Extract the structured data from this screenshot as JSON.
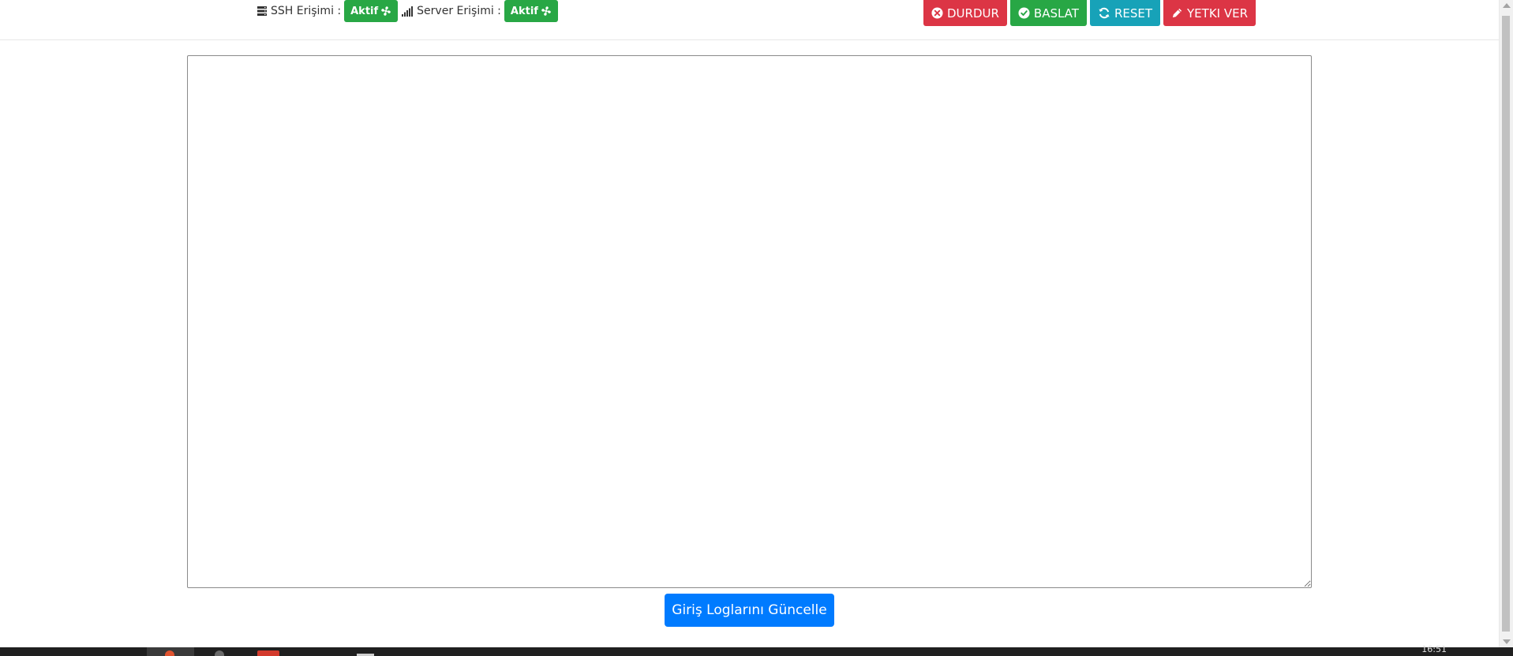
{
  "header": {
    "ssh_label": "SSH Erişimi :",
    "ssh_status": "Aktif",
    "server_label": "Server Erişimi :",
    "server_status": "Aktif"
  },
  "actions": {
    "stop": "DURDUR",
    "start": "BASLAT",
    "reset": "RESET",
    "grant": "YETKI VER"
  },
  "log": {
    "value": ""
  },
  "update_button": "Giriş Loglarını Güncelle",
  "taskbar": {
    "clock": "16:51"
  },
  "colors": {
    "success": "#28a745",
    "danger": "#dc3545",
    "info": "#17a2b8",
    "primary": "#007bff"
  },
  "icons": {
    "ssh": "server-stack-icon",
    "server": "signal-bars-icon",
    "badge": "fan-icon",
    "stop": "circle-x-icon",
    "start": "circle-check-icon",
    "reset": "refresh-icon",
    "grant": "pencil-icon"
  }
}
